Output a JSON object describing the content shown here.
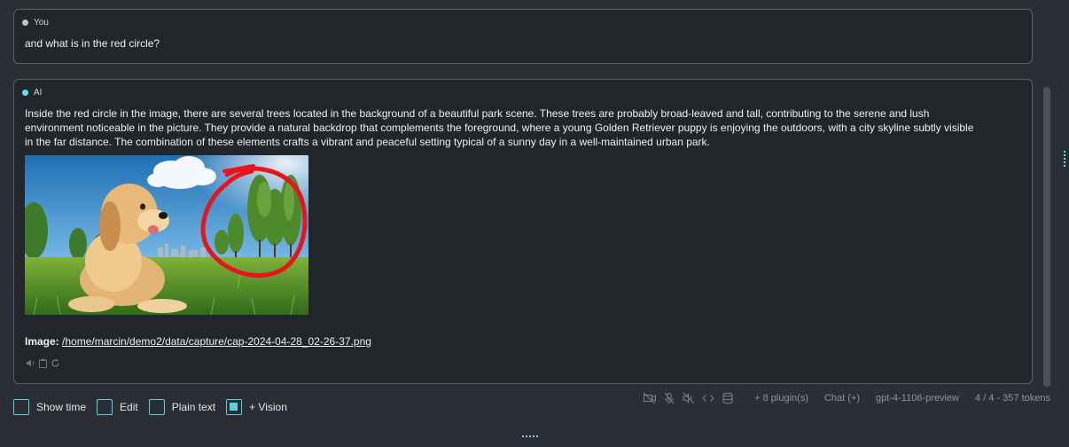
{
  "messages": {
    "user": {
      "sender": "You",
      "text": "and what is in the red circle?"
    },
    "ai": {
      "sender": "AI",
      "text_lines": [
        "Inside the red circle in the image, there are several trees located in the background of a beautiful park scene. These trees are probably broad-leaved and tall, contributing to the serene and lush",
        "environment noticeable in the picture. They provide a natural backdrop that complements the foreground, where a young Golden Retriever puppy is enjoying the outdoors, with a city skyline subtly visible",
        "in the far distance. The combination of these elements crafts a vibrant and peaceful setting typical of a sunny day in a well-maintained urban park."
      ],
      "image_label": "Image:",
      "image_path": "/home/marcin/demo2/data/capture/cap-2024-04-28_02-26-37.png",
      "actions": [
        "speaker-icon",
        "clipboard-icon",
        "refresh-icon"
      ]
    }
  },
  "options": {
    "show_time": {
      "label": "Show time",
      "checked": false
    },
    "edit": {
      "label": "Edit",
      "checked": false
    },
    "plain_text": {
      "label": "Plain text",
      "checked": false
    },
    "vision": {
      "label": "+ Vision",
      "checked": true
    }
  },
  "status": {
    "icons": [
      "camera-off-icon",
      "mic-off-icon",
      "audio-off-icon",
      "code-icon",
      "database-icon"
    ],
    "plugins": "+ 8 plugin(s)",
    "mode": "Chat (+)",
    "model": "gpt-4-1106-preview",
    "tokens": "4 / 4 - 357 tokens"
  },
  "colors": {
    "accent": "#59d2e6",
    "background": "#2b2f35",
    "message_bg": "#22262b",
    "red_circle": "#e8141a"
  }
}
